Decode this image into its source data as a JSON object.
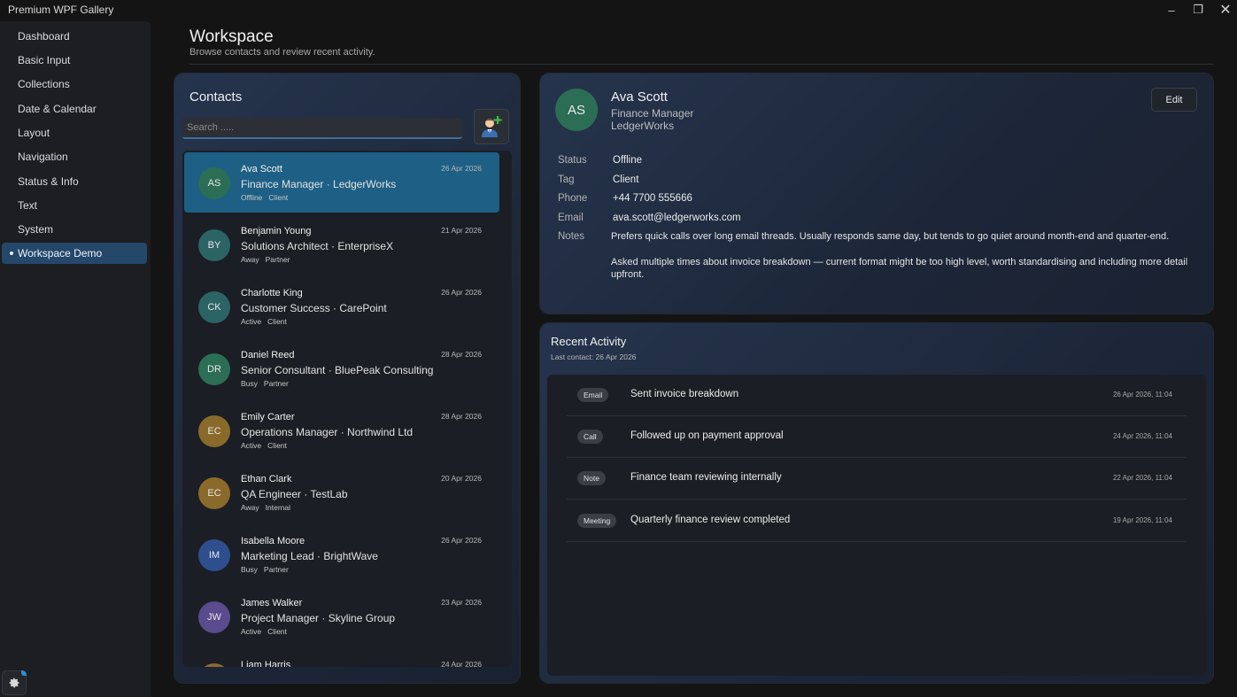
{
  "app": {
    "title": "Premium WPF Gallery"
  },
  "window_controls": {
    "minimize": "–",
    "maximize": "❐",
    "close": "✕"
  },
  "sidebar": {
    "items": [
      {
        "label": "Dashboard"
      },
      {
        "label": "Basic Input"
      },
      {
        "label": "Collections"
      },
      {
        "label": "Date & Calendar"
      },
      {
        "label": "Layout"
      },
      {
        "label": "Navigation"
      },
      {
        "label": "Status & Info"
      },
      {
        "label": "Text"
      },
      {
        "label": "System"
      },
      {
        "label": "Workspace Demo",
        "active": true
      }
    ],
    "theme_icon": "gear-icon"
  },
  "header": {
    "title": "Workspace",
    "subtitle": "Browse contacts and review recent activity."
  },
  "contacts": {
    "title": "Contacts",
    "search_placeholder": "Search .....",
    "add_icon": "add-contact-icon",
    "list": [
      {
        "initials": "AS",
        "name": "Ava Scott",
        "role": "Finance Manager · LedgerWorks",
        "status": "Offline",
        "tag": "Client",
        "date": "26 Apr 2026",
        "color": "#2b6e55",
        "selected": true
      },
      {
        "initials": "BY",
        "name": "Benjamin Young",
        "role": "Solutions Architect · EnterpriseX",
        "status": "Away",
        "tag": "Partner",
        "date": "21 Apr 2026",
        "color": "#2c6466"
      },
      {
        "initials": "CK",
        "name": "Charlotte King",
        "role": "Customer Success · CarePoint",
        "status": "Active",
        "tag": "Client",
        "date": "26 Apr 2026",
        "color": "#2c6466"
      },
      {
        "initials": "DR",
        "name": "Daniel Reed",
        "role": "Senior Consultant · BluePeak Consulting",
        "status": "Busy",
        "tag": "Partner",
        "date": "28 Apr 2026",
        "color": "#2b6e55"
      },
      {
        "initials": "EC",
        "name": "Emily Carter",
        "role": "Operations Manager · Northwind Ltd",
        "status": "Active",
        "tag": "Client",
        "date": "28 Apr 2026",
        "color": "#8a6a2a"
      },
      {
        "initials": "EC",
        "name": "Ethan Clark",
        "role": "QA Engineer · TestLab",
        "status": "Away",
        "tag": "Internal",
        "date": "20 Apr 2026",
        "color": "#8a6a2a"
      },
      {
        "initials": "IM",
        "name": "Isabella Moore",
        "role": "Marketing Lead · BrightWave",
        "status": "Busy",
        "tag": "Partner",
        "date": "26 Apr 2026",
        "color": "#2f4e8e"
      },
      {
        "initials": "JW",
        "name": "James Walker",
        "role": "Project Manager · Skyline Group",
        "status": "Active",
        "tag": "Client",
        "date": "23 Apr 2026",
        "color": "#5a4a8e"
      },
      {
        "initials": "",
        "name": "Liam Harris",
        "role": "",
        "status": "",
        "tag": "",
        "date": "24 Apr 2026",
        "color": "#8a6a2a"
      }
    ]
  },
  "detail": {
    "initials": "AS",
    "name": "Ava Scott",
    "title": "Finance Manager",
    "company": "LedgerWorks",
    "edit_label": "Edit",
    "fields": [
      {
        "label": "Status",
        "value": "Offline"
      },
      {
        "label": "Tag",
        "value": "Client"
      },
      {
        "label": "Phone",
        "value": "+44 7700 555666"
      },
      {
        "label": "Email",
        "value": "ava.scott@ledgerworks.com"
      }
    ],
    "notes_label": "Notes",
    "notes": [
      "Prefers quick calls over long email threads. Usually responds same day, but tends to go quiet around month-end and quarter-end.",
      "Asked multiple times about invoice breakdown — current format might be too high level, worth standardising and including more detail upfront."
    ]
  },
  "activity": {
    "title": "Recent Activity",
    "subtitle": "Last contact: 26 Apr 2026",
    "items": [
      {
        "type": "Email",
        "text": "Sent invoice breakdown",
        "time": "26 Apr 2026, 11:04"
      },
      {
        "type": "Call",
        "text": "Followed up on payment approval",
        "time": "24 Apr 2026, 11:04"
      },
      {
        "type": "Note",
        "text": "Finance team reviewing internally",
        "time": "22 Apr 2026, 11:04"
      },
      {
        "type": "Meeting",
        "text": "Quarterly finance review completed",
        "time": "19 Apr 2026, 11:04"
      }
    ]
  }
}
